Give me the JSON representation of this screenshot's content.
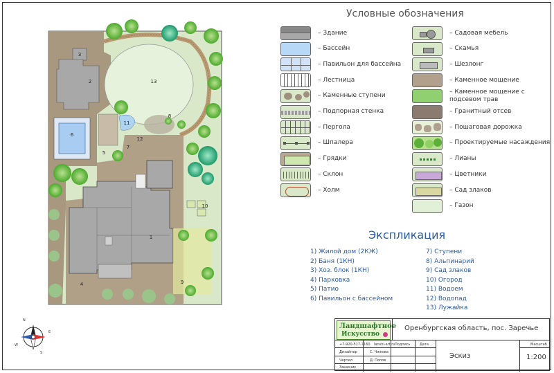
{
  "legend": {
    "title": "Условные обозначения",
    "left_items": [
      {
        "label": "Здание",
        "icon": "building-swatch"
      },
      {
        "label": "Бассейн",
        "icon": "pool-swatch"
      },
      {
        "label": "Павильон для бассейна",
        "icon": "pool-pavilion-swatch"
      },
      {
        "label": "Лестница",
        "icon": "stairs-swatch"
      },
      {
        "label": "Каменные ступени",
        "icon": "stone-steps-swatch"
      },
      {
        "label": "Подпорная стенка",
        "icon": "retaining-wall-swatch"
      },
      {
        "label": "Пергола",
        "icon": "pergola-swatch"
      },
      {
        "label": "Шпалера",
        "icon": "trellis-swatch"
      },
      {
        "label": "Грядки",
        "icon": "garden-beds-swatch"
      },
      {
        "label": "Склон",
        "icon": "slope-swatch"
      },
      {
        "label": "Холм",
        "icon": "hill-swatch"
      }
    ],
    "right_items": [
      {
        "label": "Садовая мебель",
        "icon": "garden-furniture-swatch"
      },
      {
        "label": "Скамья",
        "icon": "bench-swatch"
      },
      {
        "label": "Шезлонг",
        "icon": "sunbed-swatch"
      },
      {
        "label": "Каменное мощение",
        "icon": "stone-paving-swatch"
      },
      {
        "label": "Каменное мощение с подсевом трав",
        "icon": "stone-paving-grass-swatch"
      },
      {
        "label": "Гранитный отсев",
        "icon": "granite-screening-swatch"
      },
      {
        "label": "Пошаговая дорожка",
        "icon": "stepping-path-swatch"
      },
      {
        "label": "Проектируемые насаждения",
        "icon": "planting-swatch"
      },
      {
        "label": "Лианы",
        "icon": "vines-swatch"
      },
      {
        "label": "Цветники",
        "icon": "flowerbeds-swatch"
      },
      {
        "label": "Сад злаков",
        "icon": "grass-garden-swatch"
      },
      {
        "label": "Газон",
        "icon": "lawn-swatch"
      }
    ]
  },
  "explication": {
    "title": "Экспликация",
    "left": [
      "1) Жилой дом (2КЖ)",
      "2) Баня (1КН)",
      "3) Хоз. блок (1КН)",
      "4) Парковка",
      "5) Патио",
      "6) Павильон с бассейном"
    ],
    "right": [
      "7) Ступени",
      "8) Альпинарий",
      "9) Сад злаков",
      "10) Огород",
      "11) Водоем",
      "12) Водопад",
      "13) Лужайка"
    ]
  },
  "plan": {
    "labels": [
      "1",
      "2",
      "3",
      "4",
      "5",
      "6",
      "7",
      "8",
      "9",
      "10",
      "11",
      "12",
      "13"
    ]
  },
  "compass": {
    "north": "N",
    "south": "S",
    "east": "E",
    "west": "W"
  },
  "title_block": {
    "logo_line1": "Ландшафтное",
    "logo_line2": "Искусство",
    "location": "Оренбургская область, пос. Заречье",
    "phone": "+7-920-517-7160",
    "site": "lanshi-art.ru",
    "col_signature": "Подпись",
    "col_date": "Дата",
    "row1_role": "Дизайнер",
    "row1_name": "С. Чижова",
    "row2_role": "Чертил",
    "row2_name": "Д. Попов",
    "row3_role": "Заказчик",
    "row3_name": "",
    "stage": "Эскиз",
    "scale_label": "Масштаб",
    "scale_value": "1:200"
  },
  "colors": {
    "building": "#a8a8a8",
    "pool": "#b8d8f8",
    "lawn": "#e2f0d8",
    "paving": "#a89880",
    "accent_text": "#2c5aa0"
  }
}
